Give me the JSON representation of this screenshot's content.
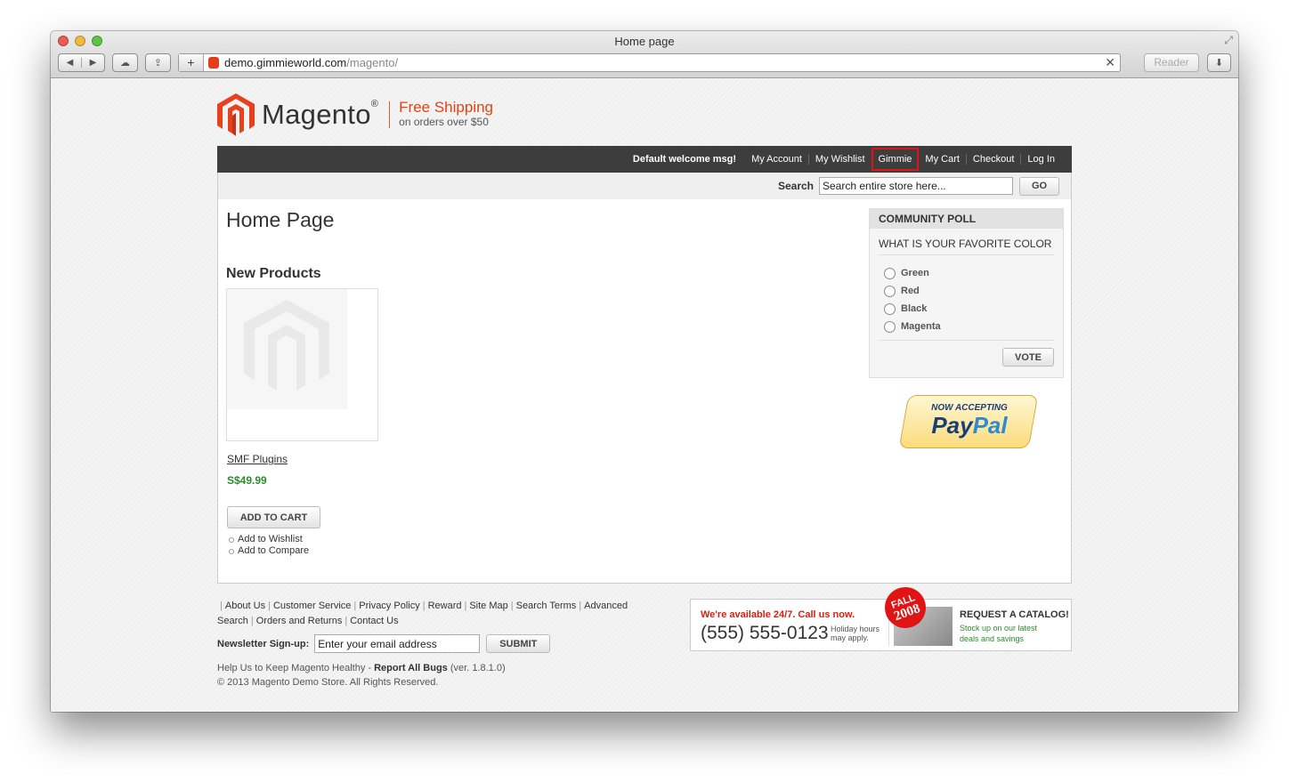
{
  "browser": {
    "window_title": "Home page",
    "url_host": "demo.gimmieworld.com",
    "url_path": "/magento/",
    "reader_label": "Reader"
  },
  "header": {
    "logo_text": "Magento",
    "logo_reg": "®",
    "tagline_1": "Free Shipping",
    "tagline_2": "on orders over $50",
    "welcome": "Default welcome msg!",
    "links": [
      "My Account",
      "My Wishlist",
      "Gimmie",
      "My Cart",
      "Checkout",
      "Log In"
    ]
  },
  "search": {
    "label": "Search",
    "value": "Search entire store here...",
    "go_label": "GO"
  },
  "main": {
    "page_title": "Home Page",
    "section_title": "New Products",
    "product": {
      "name": "SMF Plugins",
      "price": "S$49.99",
      "add_to_cart": "ADD TO CART",
      "wishlist": "Add to Wishlist",
      "compare": "Add to Compare"
    }
  },
  "poll": {
    "title": "COMMUNITY POLL",
    "question": "WHAT IS YOUR FAVORITE COLOR",
    "options": [
      "Green",
      "Red",
      "Black",
      "Magenta"
    ],
    "vote_label": "VOTE"
  },
  "paypal": {
    "line_1": "NOW ACCEPTING",
    "line_2a": "Pay",
    "line_2b": "Pal"
  },
  "footer": {
    "links": [
      "About Us",
      "Customer Service",
      "Privacy Policy",
      "Reward",
      "Site Map",
      "Search Terms",
      "Advanced Search",
      "Orders and Returns",
      "Contact Us"
    ],
    "newsletter_label": "Newsletter Sign-up:",
    "newsletter_value": "Enter your email address",
    "submit_label": "SUBMIT",
    "help_prefix": "Help Us to Keep Magento Healthy - ",
    "help_link": "Report All Bugs",
    "help_suffix": " (ver. 1.8.1.0)",
    "copyright": "© 2013 Magento Demo Store. All Rights Reserved."
  },
  "callout": {
    "available": "We're available 24/7. Call us now.",
    "phone": "(555) 555-0123",
    "hours_1": "Holiday hours",
    "hours_2": "may apply.",
    "badge_1": "FALL",
    "badge_2": "2008",
    "catalog_title": "REQUEST A CATALOG!",
    "catalog_sub_1": "Stock up on our latest",
    "catalog_sub_2": "deals and savings"
  }
}
